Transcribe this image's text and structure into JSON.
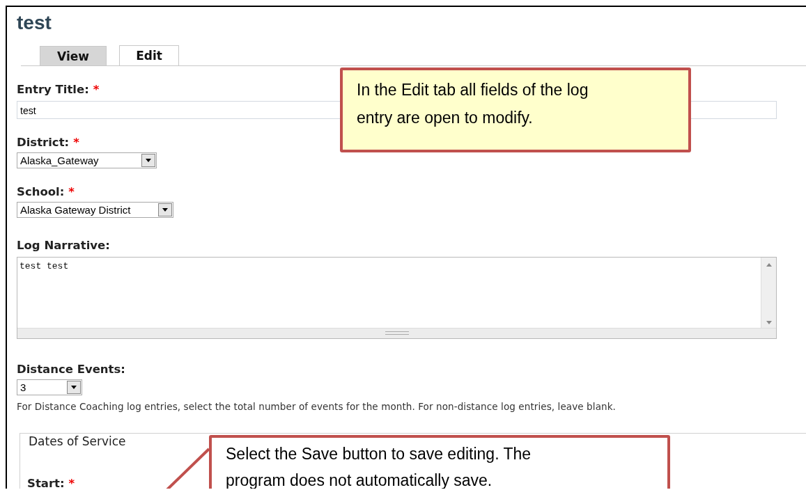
{
  "page_title": "test",
  "tabs": [
    {
      "label": "View",
      "selected": false
    },
    {
      "label": "Edit",
      "selected": true
    }
  ],
  "fields": [
    {
      "kind": "text",
      "label": "Entry Title:",
      "required_mark": "*",
      "value": "test"
    },
    {
      "kind": "select",
      "label": "District:",
      "required_mark": "*",
      "value": "Alaska_Gateway"
    },
    {
      "kind": "select",
      "label": "School:",
      "required_mark": "*",
      "value": "Alaska Gateway District"
    },
    {
      "kind": "textarea",
      "label": "Log Narrative:",
      "value": "test test"
    },
    {
      "kind": "select",
      "label": "Distance Events:",
      "value": "3",
      "help": "For Distance Coaching log entries, select the total number of events for the month. For non-distance log entries, leave blank."
    }
  ],
  "fieldset": {
    "legend": "Dates of Service",
    "fields": [
      {
        "label": "Start:",
        "required_mark": "*"
      }
    ]
  },
  "callouts": [
    {
      "kind": "note",
      "lines": [
        "In the Edit tab all fields of the log",
        "entry are open to modify."
      ]
    },
    {
      "kind": "pointer",
      "lines": [
        "Select the Save button to save editing. The",
        "program does not automatically save."
      ]
    }
  ]
}
